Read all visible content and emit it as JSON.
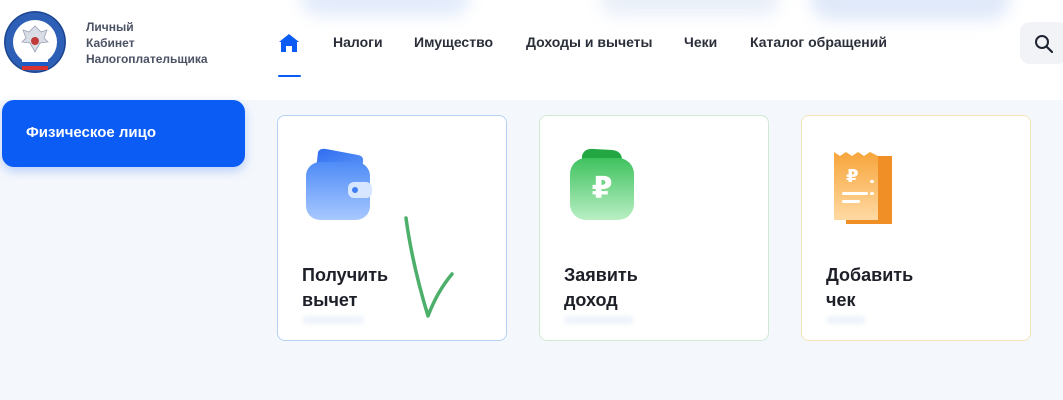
{
  "brand": {
    "line1": "Личный",
    "line2": "Кабинет",
    "line3": "Налогоплательщика"
  },
  "nav": {
    "items": [
      "Налоги",
      "Имущество",
      "Доходы и вычеты",
      "Чеки",
      "Каталог обращений"
    ]
  },
  "sidebar": {
    "person_type": "Физическое лицо"
  },
  "cards": [
    {
      "line1": "Получить",
      "line2": "вычет",
      "icon": "wallet-icon"
    },
    {
      "line1": "Заявить",
      "line2": "доход",
      "icon": "ruble-wallet-icon"
    },
    {
      "line1": "Добавить",
      "line2": "чек",
      "icon": "receipt-icon"
    }
  ],
  "colors": {
    "accent": "#0a5cf5",
    "annotation": "#4caf6a"
  }
}
